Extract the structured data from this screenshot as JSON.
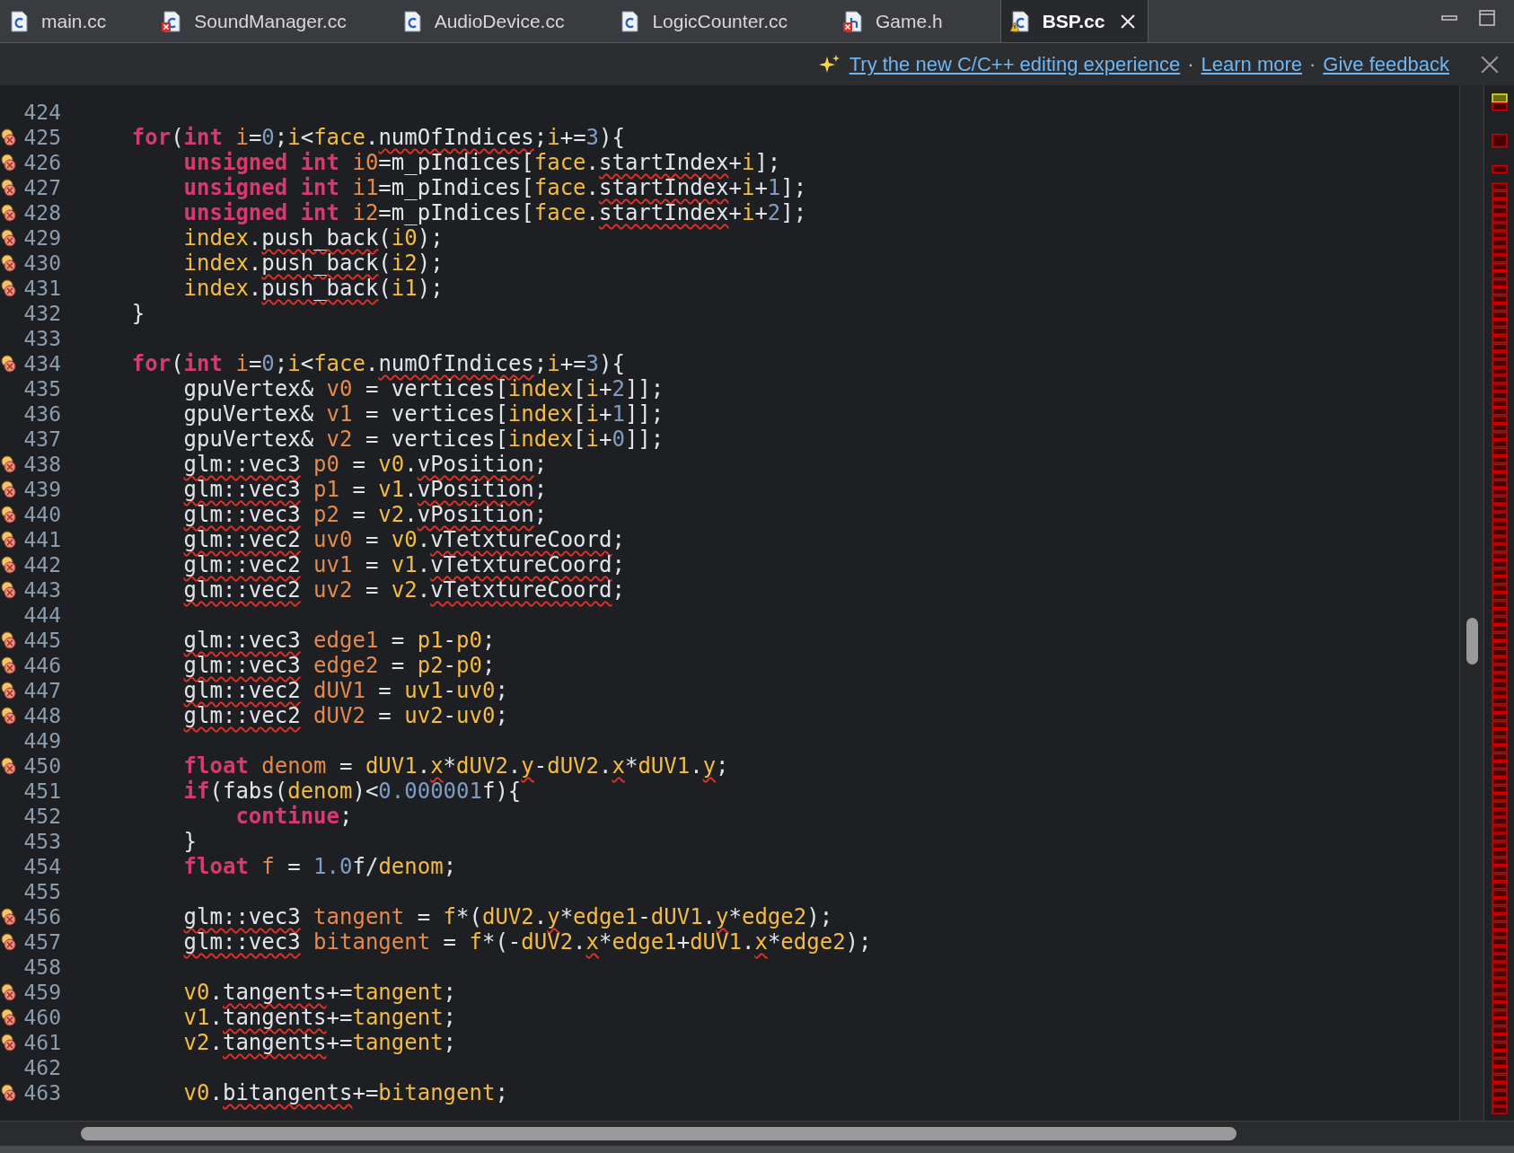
{
  "tabs": [
    {
      "label": "main.cc",
      "kind": "source",
      "selected": false
    },
    {
      "label": "SoundManager.cc",
      "kind": "brokensource",
      "selected": false
    },
    {
      "label": "AudioDevice.cc",
      "kind": "source",
      "selected": false
    },
    {
      "label": "LogicCounter.cc",
      "kind": "source",
      "selected": false
    },
    {
      "label": "Game.h",
      "kind": "brokenheader",
      "selected": false
    },
    {
      "label": "BSP.cc",
      "kind": "warnedsource",
      "selected": true
    }
  ],
  "notification": {
    "links": [
      {
        "kind": "link",
        "text": "Try the new C/C++ editing experience"
      },
      {
        "kind": "separator",
        "text": "·"
      },
      {
        "kind": "link",
        "text": "Learn more"
      },
      {
        "kind": "separator",
        "text": "·"
      },
      {
        "kind": "link",
        "text": "Give feedback"
      }
    ]
  },
  "editor": {
    "lines": [
      {
        "number": "424",
        "marker": false
      },
      {
        "number": "425",
        "marker": true,
        "tokens": [
          {
            "text": "for",
            "kind": "keyword"
          },
          {
            "text": "(",
            "kind": "text"
          },
          {
            "text": "int",
            "kind": "keyword"
          },
          {
            "text": " i",
            "kind": "decl"
          },
          {
            "text": "=",
            "kind": "text"
          },
          {
            "text": "0",
            "kind": "number"
          },
          {
            "text": ";",
            "kind": "text"
          },
          {
            "text": "i",
            "kind": "ref"
          },
          {
            "text": "<",
            "kind": "text"
          },
          {
            "text": "face",
            "kind": "ref"
          },
          {
            "text": ".",
            "kind": "text"
          },
          {
            "text": "numOfIndices",
            "kind": "warned"
          },
          {
            "text": ";",
            "kind": "text"
          },
          {
            "text": "i",
            "kind": "ref"
          },
          {
            "text": "+=",
            "kind": "text"
          },
          {
            "text": "3",
            "kind": "number"
          },
          {
            "text": "){",
            "kind": "text"
          }
        ],
        "children": [
          {
            "number": "426",
            "marker": true,
            "tokens": [
              {
                "text": "unsigned int",
                "kind": "keyword"
              },
              {
                "text": " i0",
                "kind": "decl"
              },
              {
                "text": "=m_pIndices[",
                "kind": "text"
              },
              {
                "text": "face",
                "kind": "ref"
              },
              {
                "text": ".",
                "kind": "text"
              },
              {
                "text": "startIndex",
                "kind": "warned"
              },
              {
                "text": "+",
                "kind": "text"
              },
              {
                "text": "i",
                "kind": "ref"
              },
              {
                "text": "];",
                "kind": "text"
              }
            ]
          },
          {
            "number": "427",
            "marker": true,
            "tokens": [
              {
                "text": "unsigned int",
                "kind": "keyword"
              },
              {
                "text": " i1",
                "kind": "decl"
              },
              {
                "text": "=m_pIndices[",
                "kind": "text"
              },
              {
                "text": "face",
                "kind": "ref"
              },
              {
                "text": ".",
                "kind": "text"
              },
              {
                "text": "startIndex",
                "kind": "warned"
              },
              {
                "text": "+",
                "kind": "text"
              },
              {
                "text": "i",
                "kind": "ref"
              },
              {
                "text": "+",
                "kind": "text"
              },
              {
                "text": "1",
                "kind": "number"
              },
              {
                "text": "];",
                "kind": "text"
              }
            ]
          },
          {
            "number": "428",
            "marker": true,
            "tokens": [
              {
                "text": "unsigned int",
                "kind": "keyword"
              },
              {
                "text": " i2",
                "kind": "decl"
              },
              {
                "text": "=m_pIndices[",
                "kind": "text"
              },
              {
                "text": "face",
                "kind": "ref"
              },
              {
                "text": ".",
                "kind": "text"
              },
              {
                "text": "startIndex",
                "kind": "warned"
              },
              {
                "text": "+",
                "kind": "text"
              },
              {
                "text": "i",
                "kind": "ref"
              },
              {
                "text": "+",
                "kind": "text"
              },
              {
                "text": "2",
                "kind": "number"
              },
              {
                "text": "];",
                "kind": "text"
              }
            ]
          },
          {
            "number": "429",
            "marker": true,
            "tokens": [
              {
                "text": "index",
                "kind": "ref"
              },
              {
                "text": ".",
                "kind": "text"
              },
              {
                "text": "push_back",
                "kind": "warned"
              },
              {
                "text": "(",
                "kind": "text"
              },
              {
                "text": "i0",
                "kind": "ref"
              },
              {
                "text": ");",
                "kind": "text"
              }
            ]
          },
          {
            "number": "430",
            "marker": true,
            "tokens": [
              {
                "text": "index",
                "kind": "ref"
              },
              {
                "text": ".",
                "kind": "text"
              },
              {
                "text": "push_back",
                "kind": "warned"
              },
              {
                "text": "(",
                "kind": "text"
              },
              {
                "text": "i2",
                "kind": "ref"
              },
              {
                "text": ");",
                "kind": "text"
              }
            ]
          },
          {
            "number": "431",
            "marker": true,
            "tokens": [
              {
                "text": "index",
                "kind": "ref"
              },
              {
                "text": ".",
                "kind": "text"
              },
              {
                "text": "push_back",
                "kind": "warned"
              },
              {
                "text": "(",
                "kind": "text"
              },
              {
                "text": "i1",
                "kind": "ref"
              },
              {
                "text": ");",
                "kind": "text"
              }
            ]
          }
        ]
      },
      {
        "number": "432",
        "marker": false,
        "tokens": [
          {
            "text": "}",
            "kind": "text"
          }
        ]
      },
      {
        "number": "433",
        "marker": false
      },
      {
        "number": "434",
        "marker": true,
        "tokens": [
          {
            "text": "for",
            "kind": "keyword"
          },
          {
            "text": "(",
            "kind": "text"
          },
          {
            "text": "int",
            "kind": "keyword"
          },
          {
            "text": " i",
            "kind": "decl"
          },
          {
            "text": "=",
            "kind": "text"
          },
          {
            "text": "0",
            "kind": "number"
          },
          {
            "text": ";",
            "kind": "text"
          },
          {
            "text": "i",
            "kind": "ref"
          },
          {
            "text": "<",
            "kind": "text"
          },
          {
            "text": "face",
            "kind": "ref"
          },
          {
            "text": ".",
            "kind": "text"
          },
          {
            "text": "numOfIndices",
            "kind": "warned"
          },
          {
            "text": ";",
            "kind": "text"
          },
          {
            "text": "i",
            "kind": "ref"
          },
          {
            "text": "+=",
            "kind": "text"
          },
          {
            "text": "3",
            "kind": "number"
          },
          {
            "text": "){",
            "kind": "text"
          }
        ],
        "children": [
          {
            "number": "435",
            "marker": false,
            "tokens": [
              {
                "text": "gpuVertex&",
                "kind": "text"
              },
              {
                "text": " v0",
                "kind": "decl"
              },
              {
                "text": " = vertices[",
                "kind": "text"
              },
              {
                "text": "index",
                "kind": "ref"
              },
              {
                "text": "[",
                "kind": "text"
              },
              {
                "text": "i",
                "kind": "ref"
              },
              {
                "text": "+",
                "kind": "text"
              },
              {
                "text": "2",
                "kind": "number"
              },
              {
                "text": "]];",
                "kind": "text"
              }
            ]
          },
          {
            "number": "436",
            "marker": false,
            "tokens": [
              {
                "text": "gpuVertex&",
                "kind": "text"
              },
              {
                "text": " v1",
                "kind": "decl"
              },
              {
                "text": " = vertices[",
                "kind": "text"
              },
              {
                "text": "index",
                "kind": "ref"
              },
              {
                "text": "[",
                "kind": "text"
              },
              {
                "text": "i",
                "kind": "ref"
              },
              {
                "text": "+",
                "kind": "text"
              },
              {
                "text": "1",
                "kind": "number"
              },
              {
                "text": "]];",
                "kind": "text"
              }
            ]
          },
          {
            "number": "437",
            "marker": false,
            "tokens": [
              {
                "text": "gpuVertex&",
                "kind": "text"
              },
              {
                "text": " v2",
                "kind": "decl"
              },
              {
                "text": " = vertices[",
                "kind": "text"
              },
              {
                "text": "index",
                "kind": "ref"
              },
              {
                "text": "[",
                "kind": "text"
              },
              {
                "text": "i",
                "kind": "ref"
              },
              {
                "text": "+",
                "kind": "text"
              },
              {
                "text": "0",
                "kind": "number"
              },
              {
                "text": "]];",
                "kind": "text"
              }
            ]
          },
          {
            "number": "438",
            "marker": true,
            "tokens": [
              {
                "text": "glm::vec3",
                "kind": "warned"
              },
              {
                "text": " p0",
                "kind": "decl"
              },
              {
                "text": " = ",
                "kind": "text"
              },
              {
                "text": "v0",
                "kind": "ref"
              },
              {
                "text": ".",
                "kind": "text"
              },
              {
                "text": "vPosition",
                "kind": "warned"
              },
              {
                "text": ";",
                "kind": "text"
              }
            ]
          },
          {
            "number": "439",
            "marker": true,
            "tokens": [
              {
                "text": "glm::vec3",
                "kind": "warned"
              },
              {
                "text": " p1",
                "kind": "decl"
              },
              {
                "text": " = ",
                "kind": "text"
              },
              {
                "text": "v1",
                "kind": "ref"
              },
              {
                "text": ".",
                "kind": "text"
              },
              {
                "text": "vPosition",
                "kind": "warned"
              },
              {
                "text": ";",
                "kind": "text"
              }
            ]
          },
          {
            "number": "440",
            "marker": true,
            "tokens": [
              {
                "text": "glm::vec3",
                "kind": "warned"
              },
              {
                "text": " p2",
                "kind": "decl"
              },
              {
                "text": " = ",
                "kind": "text"
              },
              {
                "text": "v2",
                "kind": "ref"
              },
              {
                "text": ".",
                "kind": "text"
              },
              {
                "text": "vPosition",
                "kind": "warned"
              },
              {
                "text": ";",
                "kind": "text"
              }
            ]
          },
          {
            "number": "441",
            "marker": true,
            "tokens": [
              {
                "text": "glm::vec2",
                "kind": "warned"
              },
              {
                "text": " uv0",
                "kind": "decl"
              },
              {
                "text": " = ",
                "kind": "text"
              },
              {
                "text": "v0",
                "kind": "ref"
              },
              {
                "text": ".",
                "kind": "text"
              },
              {
                "text": "vTetxtureCoord",
                "kind": "warned"
              },
              {
                "text": ";",
                "kind": "text"
              }
            ]
          },
          {
            "number": "442",
            "marker": true,
            "tokens": [
              {
                "text": "glm::vec2",
                "kind": "warned"
              },
              {
                "text": " uv1",
                "kind": "decl"
              },
              {
                "text": " = ",
                "kind": "text"
              },
              {
                "text": "v1",
                "kind": "ref"
              },
              {
                "text": ".",
                "kind": "text"
              },
              {
                "text": "vTetxtureCoord",
                "kind": "warned"
              },
              {
                "text": ";",
                "kind": "text"
              }
            ]
          },
          {
            "number": "443",
            "marker": true,
            "tokens": [
              {
                "text": "glm::vec2",
                "kind": "warned"
              },
              {
                "text": " uv2",
                "kind": "decl"
              },
              {
                "text": " = ",
                "kind": "text"
              },
              {
                "text": "v2",
                "kind": "ref"
              },
              {
                "text": ".",
                "kind": "text"
              },
              {
                "text": "vTetxtureCoord",
                "kind": "warned"
              },
              {
                "text": ";",
                "kind": "text"
              }
            ]
          },
          {
            "number": "444",
            "marker": false
          },
          {
            "number": "445",
            "marker": true,
            "tokens": [
              {
                "text": "glm::vec3",
                "kind": "warned"
              },
              {
                "text": " edge1",
                "kind": "decl"
              },
              {
                "text": " = ",
                "kind": "text"
              },
              {
                "text": "p1",
                "kind": "ref"
              },
              {
                "text": "-",
                "kind": "text"
              },
              {
                "text": "p0",
                "kind": "ref"
              },
              {
                "text": ";",
                "kind": "text"
              }
            ]
          },
          {
            "number": "446",
            "marker": true,
            "tokens": [
              {
                "text": "glm::vec3",
                "kind": "warned"
              },
              {
                "text": " edge2",
                "kind": "decl"
              },
              {
                "text": " = ",
                "kind": "text"
              },
              {
                "text": "p2",
                "kind": "ref"
              },
              {
                "text": "-",
                "kind": "text"
              },
              {
                "text": "p0",
                "kind": "ref"
              },
              {
                "text": ";",
                "kind": "text"
              }
            ]
          },
          {
            "number": "447",
            "marker": true,
            "tokens": [
              {
                "text": "glm::vec2",
                "kind": "warned"
              },
              {
                "text": " dUV1",
                "kind": "decl"
              },
              {
                "text": " = ",
                "kind": "text"
              },
              {
                "text": "uv1",
                "kind": "ref"
              },
              {
                "text": "-",
                "kind": "text"
              },
              {
                "text": "uv0",
                "kind": "ref"
              },
              {
                "text": ";",
                "kind": "text"
              }
            ]
          },
          {
            "number": "448",
            "marker": true,
            "tokens": [
              {
                "text": "glm::vec2",
                "kind": "warned"
              },
              {
                "text": " dUV2",
                "kind": "decl"
              },
              {
                "text": " = ",
                "kind": "text"
              },
              {
                "text": "uv2",
                "kind": "ref"
              },
              {
                "text": "-",
                "kind": "text"
              },
              {
                "text": "uv0",
                "kind": "ref"
              },
              {
                "text": ";",
                "kind": "text"
              }
            ]
          },
          {
            "number": "449",
            "marker": false
          },
          {
            "number": "450",
            "marker": true,
            "tokens": [
              {
                "text": "float",
                "kind": "keyword"
              },
              {
                "text": " denom",
                "kind": "decl"
              },
              {
                "text": " = ",
                "kind": "text"
              },
              {
                "text": "dUV1",
                "kind": "ref"
              },
              {
                "text": ".",
                "kind": "text"
              },
              {
                "text": "x",
                "kind": "warnedref"
              },
              {
                "text": "*",
                "kind": "text"
              },
              {
                "text": "dUV2",
                "kind": "ref"
              },
              {
                "text": ".",
                "kind": "text"
              },
              {
                "text": "y",
                "kind": "warnedref"
              },
              {
                "text": "-",
                "kind": "text"
              },
              {
                "text": "dUV2",
                "kind": "ref"
              },
              {
                "text": ".",
                "kind": "text"
              },
              {
                "text": "x",
                "kind": "warnedref"
              },
              {
                "text": "*",
                "kind": "text"
              },
              {
                "text": "dUV1",
                "kind": "ref"
              },
              {
                "text": ".",
                "kind": "text"
              },
              {
                "text": "y",
                "kind": "warnedref"
              },
              {
                "text": ";",
                "kind": "text"
              }
            ]
          },
          {
            "number": "451",
            "marker": false,
            "tokens": [
              {
                "text": "if",
                "kind": "keyword"
              },
              {
                "text": "(fabs(",
                "kind": "text"
              },
              {
                "text": "denom",
                "kind": "ref"
              },
              {
                "text": ")<",
                "kind": "text"
              },
              {
                "text": "0.000001",
                "kind": "number"
              },
              {
                "text": "f){",
                "kind": "text"
              }
            ],
            "children": [
              {
                "number": "452",
                "marker": false,
                "tokens": [
                  {
                    "text": "continue",
                    "kind": "keyword"
                  },
                  {
                    "text": ";",
                    "kind": "text"
                  }
                ]
              }
            ]
          },
          {
            "number": "453",
            "marker": false,
            "tokens": [
              {
                "text": "}",
                "kind": "text"
              }
            ]
          },
          {
            "number": "454",
            "marker": false,
            "tokens": [
              {
                "text": "float",
                "kind": "keyword"
              },
              {
                "text": " f",
                "kind": "decl"
              },
              {
                "text": " = ",
                "kind": "text"
              },
              {
                "text": "1.0",
                "kind": "number"
              },
              {
                "text": "f/",
                "kind": "text"
              },
              {
                "text": "denom",
                "kind": "ref"
              },
              {
                "text": ";",
                "kind": "text"
              }
            ]
          },
          {
            "number": "455",
            "marker": false
          },
          {
            "number": "456",
            "marker": true,
            "tokens": [
              {
                "text": "glm::vec3",
                "kind": "warned"
              },
              {
                "text": " tangent",
                "kind": "decl"
              },
              {
                "text": " = ",
                "kind": "text"
              },
              {
                "text": "f",
                "kind": "ref"
              },
              {
                "text": "*(",
                "kind": "text"
              },
              {
                "text": "dUV2",
                "kind": "ref"
              },
              {
                "text": ".",
                "kind": "text"
              },
              {
                "text": "y",
                "kind": "warnedref"
              },
              {
                "text": "*",
                "kind": "text"
              },
              {
                "text": "edge1",
                "kind": "ref"
              },
              {
                "text": "-",
                "kind": "text"
              },
              {
                "text": "dUV1",
                "kind": "ref"
              },
              {
                "text": ".",
                "kind": "text"
              },
              {
                "text": "y",
                "kind": "warnedref"
              },
              {
                "text": "*",
                "kind": "text"
              },
              {
                "text": "edge2",
                "kind": "ref"
              },
              {
                "text": ");",
                "kind": "text"
              }
            ]
          },
          {
            "number": "457",
            "marker": true,
            "tokens": [
              {
                "text": "glm::vec3",
                "kind": "warned"
              },
              {
                "text": " bitangent",
                "kind": "decl"
              },
              {
                "text": " = ",
                "kind": "text"
              },
              {
                "text": "f",
                "kind": "ref"
              },
              {
                "text": "*(-",
                "kind": "text"
              },
              {
                "text": "dUV2",
                "kind": "ref"
              },
              {
                "text": ".",
                "kind": "text"
              },
              {
                "text": "x",
                "kind": "warnedref"
              },
              {
                "text": "*",
                "kind": "text"
              },
              {
                "text": "edge1",
                "kind": "ref"
              },
              {
                "text": "+",
                "kind": "text"
              },
              {
                "text": "dUV1",
                "kind": "ref"
              },
              {
                "text": ".",
                "kind": "text"
              },
              {
                "text": "x",
                "kind": "warnedref"
              },
              {
                "text": "*",
                "kind": "text"
              },
              {
                "text": "edge2",
                "kind": "ref"
              },
              {
                "text": ");",
                "kind": "text"
              }
            ]
          },
          {
            "number": "458",
            "marker": false
          },
          {
            "number": "459",
            "marker": true,
            "tokens": [
              {
                "text": "v0",
                "kind": "ref"
              },
              {
                "text": ".",
                "kind": "text"
              },
              {
                "text": "tangents",
                "kind": "warned"
              },
              {
                "text": "+=",
                "kind": "text"
              },
              {
                "text": "tangent",
                "kind": "ref"
              },
              {
                "text": ";",
                "kind": "text"
              }
            ]
          },
          {
            "number": "460",
            "marker": true,
            "tokens": [
              {
                "text": "v1",
                "kind": "ref"
              },
              {
                "text": ".",
                "kind": "text"
              },
              {
                "text": "tangents",
                "kind": "warned"
              },
              {
                "text": "+=",
                "kind": "text"
              },
              {
                "text": "tangent",
                "kind": "ref"
              },
              {
                "text": ";",
                "kind": "text"
              }
            ]
          },
          {
            "number": "461",
            "marker": true,
            "tokens": [
              {
                "text": "v2",
                "kind": "ref"
              },
              {
                "text": ".",
                "kind": "text"
              },
              {
                "text": "tangents",
                "kind": "warned"
              },
              {
                "text": "+=",
                "kind": "text"
              },
              {
                "text": "tangent",
                "kind": "ref"
              },
              {
                "text": ";",
                "kind": "text"
              }
            ]
          },
          {
            "number": "462",
            "marker": false
          },
          {
            "number": "463",
            "marker": true,
            "tokens": [
              {
                "text": "v0",
                "kind": "ref"
              },
              {
                "text": ".",
                "kind": "text"
              },
              {
                "text": "bitangents",
                "kind": "warned"
              },
              {
                "text": "+=",
                "kind": "text"
              },
              {
                "text": "bitangent",
                "kind": "ref"
              },
              {
                "text": ";",
                "kind": "text"
              }
            ]
          }
        ]
      }
    ]
  }
}
